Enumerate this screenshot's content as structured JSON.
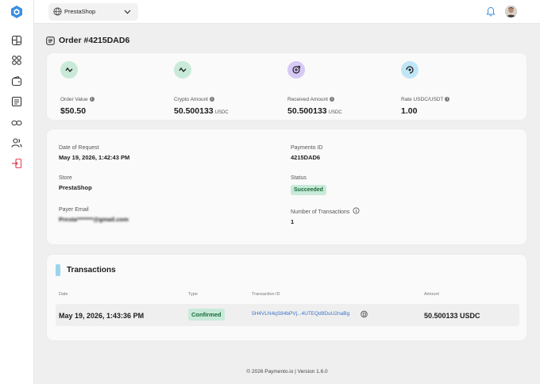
{
  "topbar": {
    "store_selected": "PrestaShop"
  },
  "page": {
    "title": "Order #4215DAD6"
  },
  "metrics": [
    {
      "label": "Order Value",
      "value": "$50.50",
      "unit": "",
      "icon": "trend-icon",
      "color": "#c9ead9"
    },
    {
      "label": "Crypto Amount",
      "value": "50.500133",
      "unit": "USDC",
      "icon": "trend-icon",
      "color": "#c9ead9"
    },
    {
      "label": "Received Amount",
      "value": "50.500133",
      "unit": "USDC",
      "icon": "coin-icon",
      "color": "#d7c9f5"
    },
    {
      "label": "Rate USDC/USDT",
      "value": "1.00",
      "unit": "",
      "icon": "exchange-icon",
      "color": "#bfe6f6"
    }
  ],
  "details": {
    "date_of_request_label": "Date of Request",
    "date_of_request": "May 19, 2026, 1:42:43 PM",
    "store_label": "Store",
    "store": "PrestaShop",
    "payer_email_label": "Payer Email",
    "payer_email": "Presta*******@gmail.com",
    "paymento_id_label": "Paymento ID",
    "paymento_id": "4215DAD6",
    "status_label": "Status",
    "status": "Succeeded",
    "num_tx_label": "Number of Transactions",
    "num_tx": "1"
  },
  "transactions": {
    "title": "Transactions",
    "headers": [
      "Date",
      "Type",
      "Transaction ID",
      "Amount"
    ],
    "rows": [
      {
        "date": "May 19, 2026, 1:43:36 PM",
        "type": "Confirmed",
        "transaction_id": "5H4VLN4qS84bPVj...4UTEQd9DuU2naBg",
        "amount": "50.500133 USDC"
      }
    ]
  },
  "footer": {
    "text": "© 2026 Paymento.io | Version 1.6.0"
  },
  "colors": {
    "accent_blue": "#3a8fe0",
    "success_bg": "#c9ead9",
    "success_text": "#1b6a3c",
    "logout_red": "#e0485a"
  }
}
